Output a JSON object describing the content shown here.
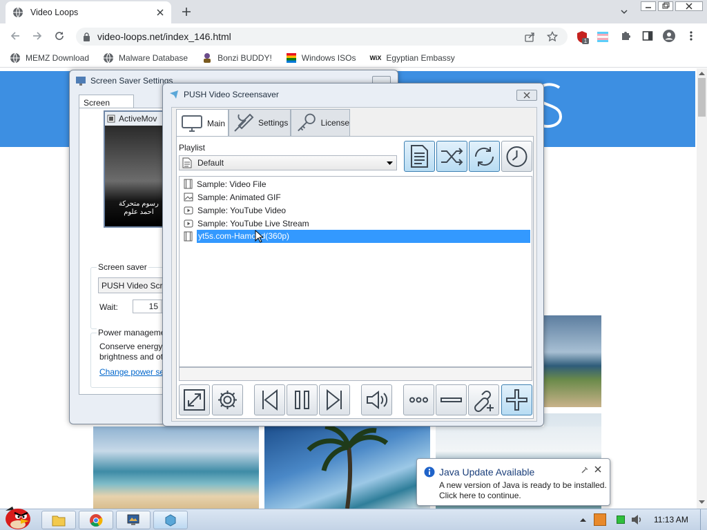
{
  "browser": {
    "tab_title": "Video Loops",
    "url": "video-loops.net/index_146.html",
    "ext_badge": "1",
    "bookmarks": [
      {
        "label": "MEMZ Download",
        "icon": "globe-icon"
      },
      {
        "label": "Malware Database",
        "icon": "globe-icon"
      },
      {
        "label": "Bonzi BUDDY!",
        "icon": "bonzi-icon"
      },
      {
        "label": "Windows ISOs",
        "icon": "windows-icon"
      },
      {
        "label": "Egyptian Embassy",
        "icon": "wix-icon",
        "icon_text": "WiX"
      }
    ]
  },
  "screensaver_settings": {
    "title": "Screen Saver Settings",
    "tab": "Screen Saver",
    "preview_title": "ActiveMov",
    "preview_caption": [
      "رسوم متحركة",
      "احمد علوم"
    ],
    "screensaver_label": "Screen saver",
    "screensaver_value": "PUSH Video Scree",
    "wait_label": "Wait:",
    "wait_value": "15",
    "power_label": "Power manageme",
    "power_text_1": "Conserve energy o",
    "power_text_2": "brightness and oth",
    "power_link": "Change power set"
  },
  "push": {
    "title": "PUSH Video Screensaver",
    "tabs": [
      {
        "label": "Main",
        "icon": "monitor-icon"
      },
      {
        "label": "Settings",
        "icon": "tools-icon"
      },
      {
        "label": "License",
        "icon": "key-icon"
      }
    ],
    "playlist_label": "Playlist",
    "playlist_value": "Default",
    "items": [
      {
        "label": "Sample: Video File",
        "icon": "film-icon"
      },
      {
        "label": "Sample: Animated GIF",
        "icon": "image-icon"
      },
      {
        "label": "Sample: YouTube Video",
        "icon": "play-icon"
      },
      {
        "label": "Sample: YouTube Live Stream",
        "icon": "play-icon"
      },
      {
        "label": "yt5s.com-Hamoud(360p)",
        "icon": "film-icon",
        "selected": true
      }
    ]
  },
  "java": {
    "title": "Java Update Available",
    "line1": "A new version of Java is ready to be installed.",
    "line2": "Click here to continue."
  },
  "taskbar": {
    "clock": "11:13 AM"
  },
  "colors": {
    "hero_blue": "#3d8fe2",
    "selection": "#3399ff",
    "button_active": "#b8dcf3"
  }
}
